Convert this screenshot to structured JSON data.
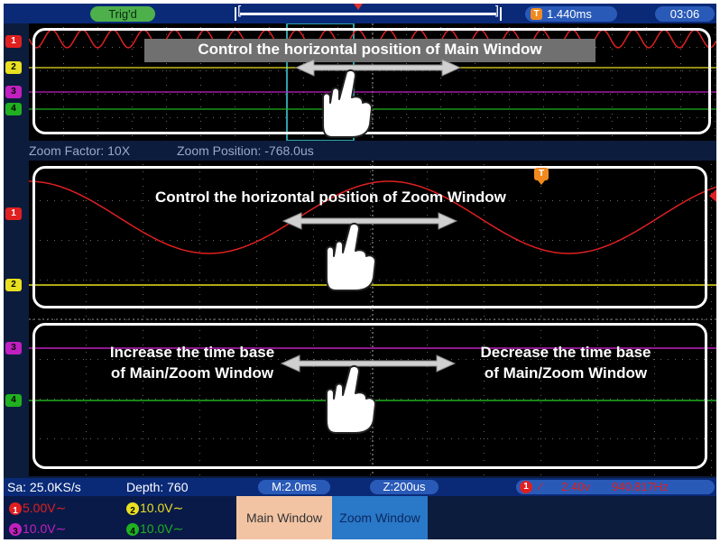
{
  "topbar": {
    "trigger_status": "Trig'd",
    "mem_left": "[",
    "mem_right": "]",
    "trigger_time_icon": "T",
    "trigger_time": "1.440ms",
    "clock": "03:06"
  },
  "channels": {
    "ch1": {
      "marker": "1",
      "color": "#e02020"
    },
    "ch2": {
      "marker": "2",
      "color": "#e8e020"
    },
    "ch3": {
      "marker": "3",
      "color": "#c020c0"
    },
    "ch4": {
      "marker": "4",
      "color": "#20b020"
    }
  },
  "annotations": {
    "main_window": "Control the horizontal position of Main Window",
    "zoom_window": "Control the horizontal position of Zoom Window",
    "increase_line1": "Increase the time base",
    "increase_line2": "of Main/Zoom Window",
    "decrease_line1": "Decrease the time base",
    "decrease_line2": "of Main/Zoom Window"
  },
  "zoom_info": {
    "factor": "Zoom Factor: 10X",
    "position": "Zoom Position: -768.0us"
  },
  "zoom_trigger_icon": "T",
  "status": {
    "sample_rate": "Sa: 25.0KS/s",
    "depth": "Depth: 760",
    "main_timebase": "M:2.0ms",
    "zoom_timebase": "Z:200us",
    "trigger_channel": "1",
    "trigger_slope": "∕",
    "trigger_level": "2.40v",
    "frequency": "940.817Hz"
  },
  "channel_settings": {
    "ch1": {
      "num": "1",
      "scale": "5.00V",
      "coupling": "∼"
    },
    "ch2": {
      "num": "2",
      "scale": "10.0V",
      "coupling": "∼"
    },
    "ch3": {
      "num": "3",
      "scale": "10.0V",
      "coupling": "∼"
    },
    "ch4": {
      "num": "4",
      "scale": "10.0V",
      "coupling": "∼"
    }
  },
  "tabs": {
    "main_window": "Main Window",
    "zoom_window": "Zoom Window"
  },
  "icons": {
    "hand": "hand-pointer-icon",
    "arrow": "double-arrow-icon"
  }
}
